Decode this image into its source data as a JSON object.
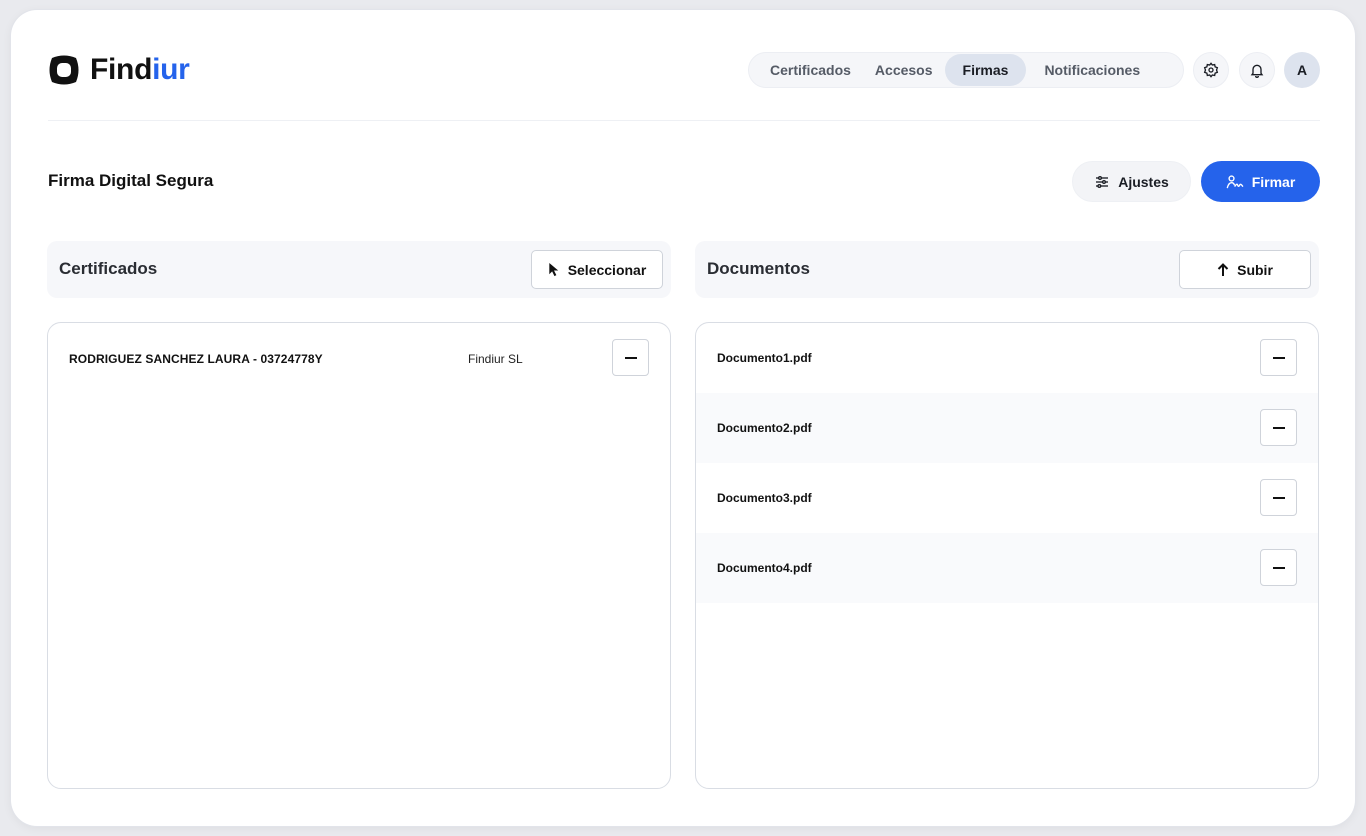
{
  "app": {
    "brand_prefix": "Find",
    "brand_suffix": "iur"
  },
  "nav": {
    "items": [
      {
        "label": "Certificados",
        "active": false
      },
      {
        "label": "Accesos",
        "active": false
      },
      {
        "label": "Firmas",
        "active": true
      },
      {
        "label": "Notificaciones",
        "active": false
      }
    ]
  },
  "header": {
    "avatar_initial": "A"
  },
  "page": {
    "title": "Firma Digital Segura",
    "ajustes_label": "Ajustes",
    "firmar_label": "Firmar"
  },
  "certificados": {
    "title": "Certificados",
    "select_label": "Seleccionar",
    "rows": [
      {
        "name": "RODRIGUEZ SANCHEZ LAURA - 03724778Y",
        "org": "Findiur SL"
      }
    ]
  },
  "documentos": {
    "title": "Documentos",
    "upload_label": "Subir",
    "rows": [
      {
        "name": "Documento1.pdf"
      },
      {
        "name": "Documento2.pdf"
      },
      {
        "name": "Documento3.pdf"
      },
      {
        "name": "Documento4.pdf"
      }
    ]
  },
  "colors": {
    "accent": "#2563eb",
    "active_tab": "#dde3ee"
  }
}
